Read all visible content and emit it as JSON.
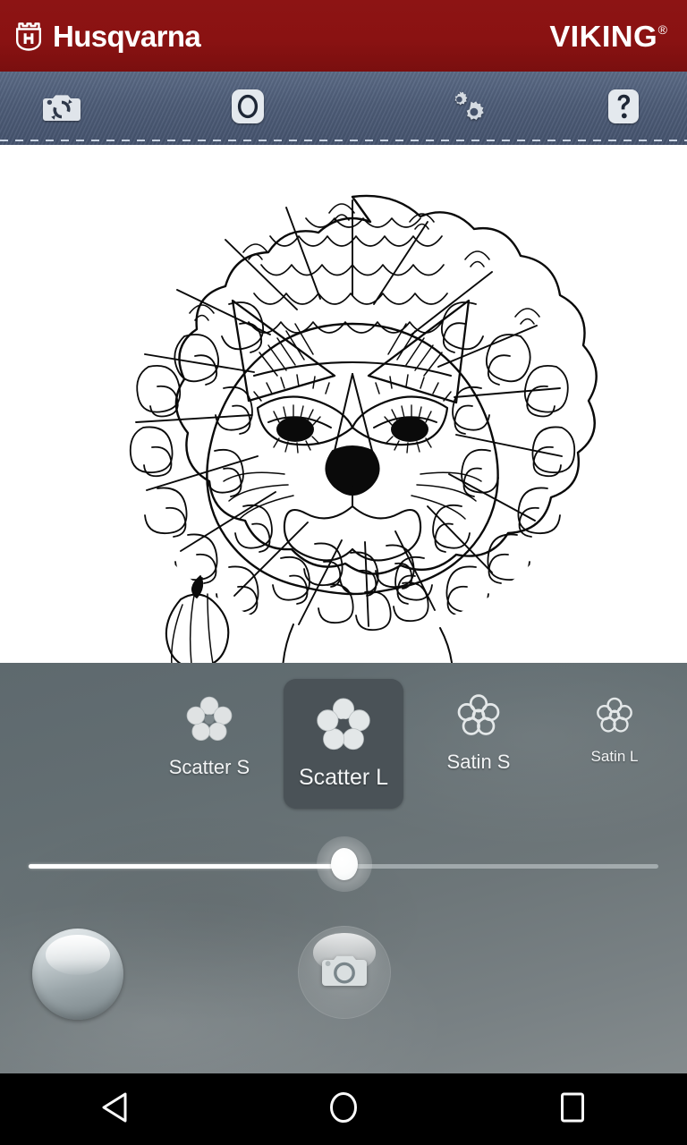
{
  "brand": {
    "logo_icon": "husqvarna-crown-shield-icon",
    "primary_name": "Husqvarna",
    "secondary_name": "VIKING",
    "registered_mark": "®",
    "bar_color": "#8a1212"
  },
  "toolbar": {
    "background": "denim-texture",
    "items": [
      {
        "id": "switch-camera",
        "icon": "camera-switch-icon",
        "label": "Switch camera"
      },
      {
        "id": "capture-mode",
        "icon": "circle-capture-icon",
        "label": "Capture mode"
      },
      {
        "id": "settings",
        "icon": "gears-icon",
        "label": "Settings"
      },
      {
        "id": "help",
        "icon": "question-mark-icon",
        "label": "Help"
      }
    ]
  },
  "canvas": {
    "artwork_name": "lion-face-line-art",
    "background": "#ffffff",
    "description": "Black and white line drawing of a lion face with patterned mane"
  },
  "panel": {
    "background_color": "#6d7679",
    "stitch_selector": {
      "selected_id": "scatter-l",
      "options": [
        {
          "id": "scatter-s",
          "label": "Scatter S",
          "icon": "flower-filled-icon",
          "style": "filled",
          "size": "small",
          "selected": false
        },
        {
          "id": "scatter-l",
          "label": "Scatter L",
          "icon": "flower-filled-icon",
          "style": "filled",
          "size": "large",
          "selected": true
        },
        {
          "id": "satin-s",
          "label": "Satin S",
          "icon": "flower-outline-icon",
          "style": "outline",
          "size": "small",
          "selected": false
        },
        {
          "id": "satin-l",
          "label": "Satin L",
          "icon": "flower-outline-icon",
          "style": "outline",
          "size": "xsmall",
          "selected": false
        }
      ],
      "selected_highlight_color": "#4a5257"
    },
    "slider": {
      "name": "density-slider",
      "value_percent": 50,
      "min": 0,
      "max": 100,
      "track_filled_color": "#ffffff",
      "track_empty_color": "#e2e8ea"
    },
    "actions": [
      {
        "id": "color-swatch",
        "icon": "color-swatch-icon",
        "label": "Color"
      },
      {
        "id": "capture-photo",
        "icon": "camera-icon",
        "label": "Capture"
      }
    ]
  },
  "navigation": {
    "buttons": [
      {
        "id": "back",
        "icon": "back-triangle-icon",
        "label": "Back"
      },
      {
        "id": "home",
        "icon": "home-circle-icon",
        "label": "Home"
      },
      {
        "id": "recents",
        "icon": "recents-square-icon",
        "label": "Recents"
      }
    ],
    "background": "#000000"
  }
}
